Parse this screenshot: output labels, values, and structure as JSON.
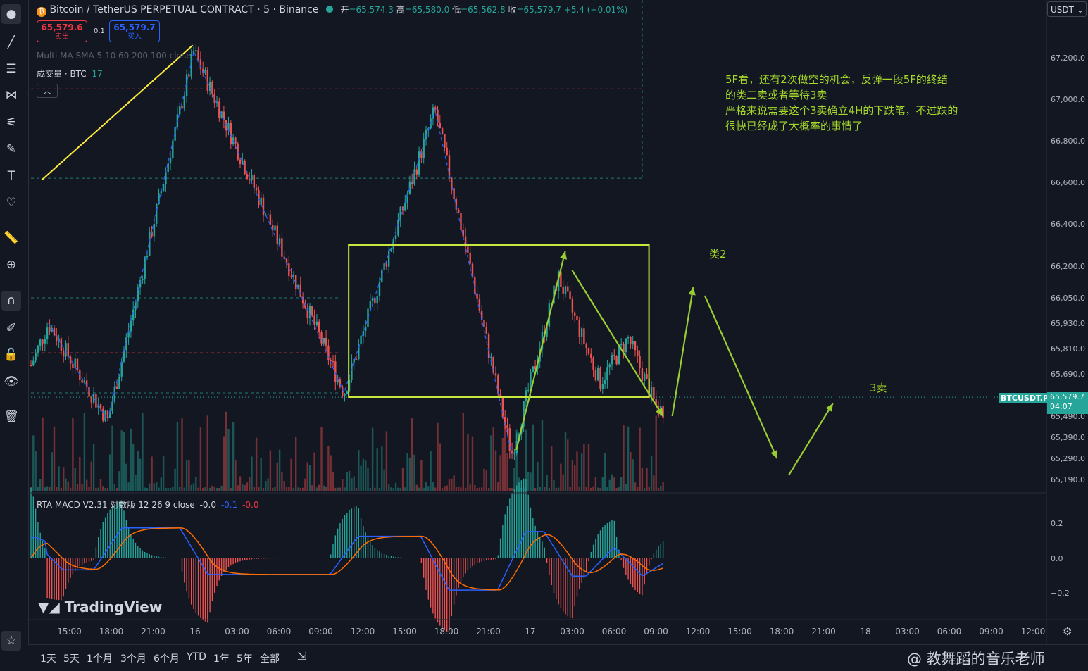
{
  "header": {
    "symbol_title": "Bitcoin / TetherUS PERPETUAL CONTRACT · 5 · Binance",
    "ohlc": [
      {
        "label": "开",
        "value": "=65,574.3"
      },
      {
        "label": "高",
        "value": "=65,580.0"
      },
      {
        "label": "低",
        "value": "=65,562.8"
      },
      {
        "label": "收",
        "value": "=65,579.7"
      }
    ],
    "change": "+5.4 (+0.01%)",
    "sell_price": "65,579.6",
    "sell_label": "卖出",
    "spread": "0.1",
    "buy_price": "65,579.7",
    "buy_label": "买入",
    "indicator_ma": "Multi MA SMA 5 10 60 200 100 close",
    "volume_label": "成交量 · BTC",
    "volume_value": "17",
    "currency": "USDT",
    "collapse_icon": "chevron-up-icon"
  },
  "macd": {
    "label": "RTA MACD V2.31 对数版 12 26 9 close",
    "v1": "-0.0",
    "v2": "-0.1",
    "v3": "-0.0"
  },
  "price_tag": {
    "symbol": "BTCUSDT.P",
    "price": "65,579.7",
    "countdown": "04:07"
  },
  "annotations": {
    "main_note": [
      "5F看，还有2次做空的机会，反弹一段5F的终结",
      "的类二卖或者等待3卖",
      "严格来说需要这个3卖确立4H的下跌笔，不过跌的",
      "很快已经成了大概率的事情了"
    ],
    "label_2": "类2",
    "label_3": "3卖"
  },
  "chart_data": {
    "type": "candlestick",
    "symbol": "BTCUSDT.P",
    "price_axis_ticks": [
      "67,200.0",
      "67,000.0",
      "66,800.0",
      "66,600.0",
      "66,400.0",
      "66,200.0",
      "66,050.0",
      "65,930.0",
      "65,810.0",
      "65,690.0",
      "65,490.0",
      "65,390.0",
      "65,290.0",
      "65,190.0"
    ],
    "macd_axis_ticks": [
      "0.2",
      "0.0",
      "−0.2"
    ],
    "time_axis_ticks": [
      "15:00",
      "18:00",
      "21:00",
      "16",
      "03:00",
      "06:00",
      "09:00",
      "12:00",
      "15:00",
      "18:00",
      "21:00",
      "17",
      "03:00",
      "06:00",
      "09:00",
      "12:00",
      "15:00",
      "18:00",
      "21:00",
      "18",
      "03:00",
      "06:00",
      "09:00",
      "12:00"
    ],
    "zigzag_pivots": [
      {
        "time": "15 13:30",
        "price": 65930
      },
      {
        "time": "15 17:45",
        "price": 65470
      },
      {
        "time": "15 23:55",
        "price": 67230
      },
      {
        "time": "16 10:40",
        "price": 65600
      },
      {
        "time": "16 17:10",
        "price": 66950
      },
      {
        "time": "16 22:40",
        "price": 65310
      }
    ],
    "trend_line": {
      "from": {
        "time": "15 13:00",
        "price": 66610
      },
      "to": {
        "time": "15 23:50",
        "price": 67260
      }
    },
    "consolidation_box": {
      "time_from": "16 11:00",
      "time_to": "17 08:30",
      "price_top": 66300,
      "price_bottom": 65580
    },
    "horizontal_levels": [
      67050,
      66620,
      66050,
      65790,
      65600
    ],
    "projection_path": [
      {
        "time": "16 23:00",
        "price": 65330
      },
      {
        "time": "17 02:30",
        "price": 66270
      },
      {
        "time": "17 03:00",
        "price": 66180
      },
      {
        "time": "17 09:30",
        "price": 65490
      },
      {
        "time": "17 10:10",
        "price": 65490
      },
      {
        "time": "17 11:40",
        "price": 66100
      },
      {
        "time": "17 12:30",
        "price": 66060
      },
      {
        "time": "17 17:40",
        "price": 65290
      },
      {
        "time": "17 18:30",
        "price": 65210
      },
      {
        "time": "17 21:40",
        "price": 65550
      }
    ],
    "last_price": 65579.7
  },
  "bottom_bar": {
    "ranges": [
      "1天",
      "5天",
      "1个月",
      "3个月",
      "6个月",
      "YTD",
      "1年",
      "5年",
      "全部"
    ],
    "watermark": "@ 教舞蹈的音乐老师",
    "logo": "TradingView"
  },
  "toolbar": {
    "icons": [
      "cursor-icon",
      "trendline-icon",
      "fib-icon",
      "pattern-icon",
      "measure-icon",
      "brush-icon",
      "text-icon",
      "heart-icon",
      "ruler-icon",
      "zoom-icon",
      "magnet-icon",
      "lock-draw-icon",
      "lock-icon",
      "eye-icon",
      "trash-icon",
      "star-icon"
    ]
  }
}
